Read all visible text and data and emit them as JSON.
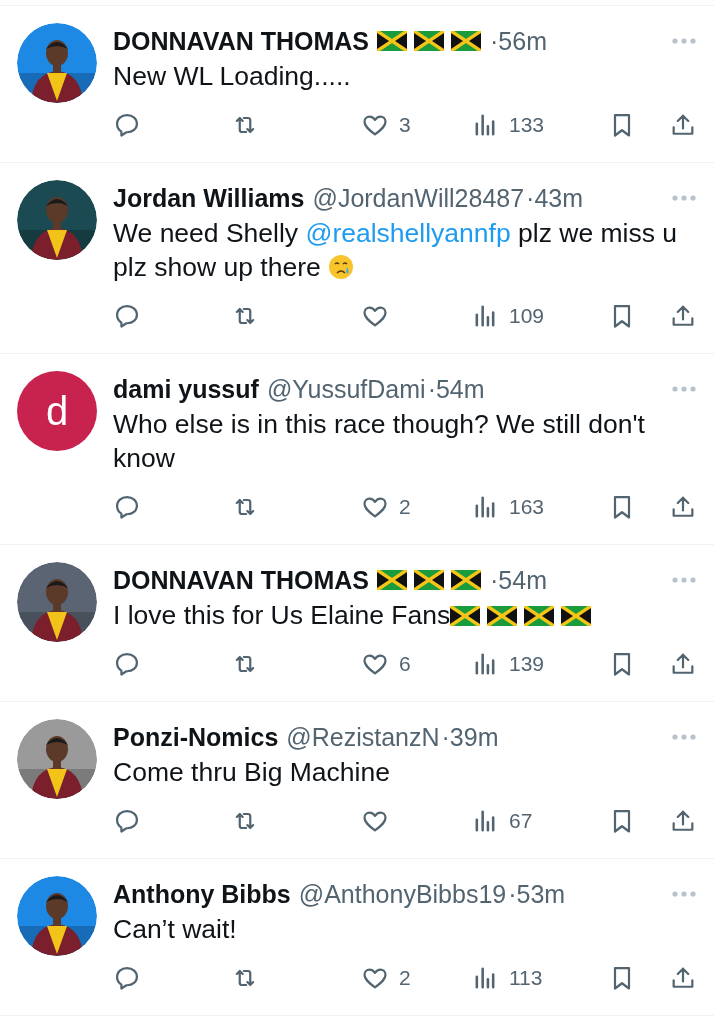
{
  "replies": [
    {
      "avatar": {
        "kind": "picture"
      },
      "name": "DONNAVAN THOMAS",
      "name_emoji": [
        {
          "kind": "jamaica-flag"
        },
        {
          "kind": "jamaica-flag"
        },
        {
          "kind": "jamaica-flag"
        }
      ],
      "time": "·56m",
      "text": [
        {
          "kind": "plain",
          "text": "New WL Loading....."
        }
      ],
      "stats": {
        "likes": "3",
        "views": "133"
      }
    },
    {
      "avatar": {
        "kind": "picture"
      },
      "name": "Jordan Williams",
      "handle": "@JordanWill28487",
      "time": "·43m",
      "text": [
        {
          "kind": "plain",
          "text": "We need Shelly "
        },
        {
          "kind": "mention",
          "text": "@realshellyannfp"
        },
        {
          "kind": "plain",
          "text": " plz we miss u plz show up there "
        }
      ],
      "text_emoji": [
        {
          "kind": "crying-face"
        }
      ],
      "stats": {
        "views": "109"
      }
    },
    {
      "avatar": {
        "kind": "letter",
        "letter": "d",
        "color": "#c8234e"
      },
      "name": "dami yussuf",
      "handle": "@YussufDami",
      "time": "·54m",
      "text": [
        {
          "kind": "plain",
          "text": "Who else is in this race though? We still don't know"
        }
      ],
      "stats": {
        "likes": "2",
        "views": "163"
      }
    },
    {
      "avatar": {
        "kind": "picture"
      },
      "name": "DONNAVAN THOMAS",
      "name_emoji": [
        {
          "kind": "jamaica-flag"
        },
        {
          "kind": "jamaica-flag"
        },
        {
          "kind": "jamaica-flag"
        }
      ],
      "time": "·54m",
      "text": [
        {
          "kind": "plain",
          "text": "I love this for Us Elaine Fans"
        }
      ],
      "text_emoji": [
        {
          "kind": "jamaica-flag"
        },
        {
          "kind": "jamaica-flag"
        },
        {
          "kind": "jamaica-flag"
        },
        {
          "kind": "jamaica-flag"
        }
      ],
      "stats": {
        "likes": "6",
        "views": "139"
      }
    },
    {
      "avatar": {
        "kind": "picture"
      },
      "name": "Ponzi-Nomics",
      "handle": "@RezistanzN",
      "time": "·39m",
      "text": [
        {
          "kind": "plain",
          "text": "Come thru Big Machine"
        }
      ],
      "stats": {
        "views": "67"
      }
    },
    {
      "avatar": {
        "kind": "picture"
      },
      "name": "Anthony Bibbs",
      "handle": "@AnthonyBibbs19",
      "time": "·53m",
      "text": [
        {
          "kind": "plain",
          "text": "Can’t wait!"
        }
      ],
      "stats": {
        "likes": "2",
        "views": "113"
      }
    }
  ]
}
